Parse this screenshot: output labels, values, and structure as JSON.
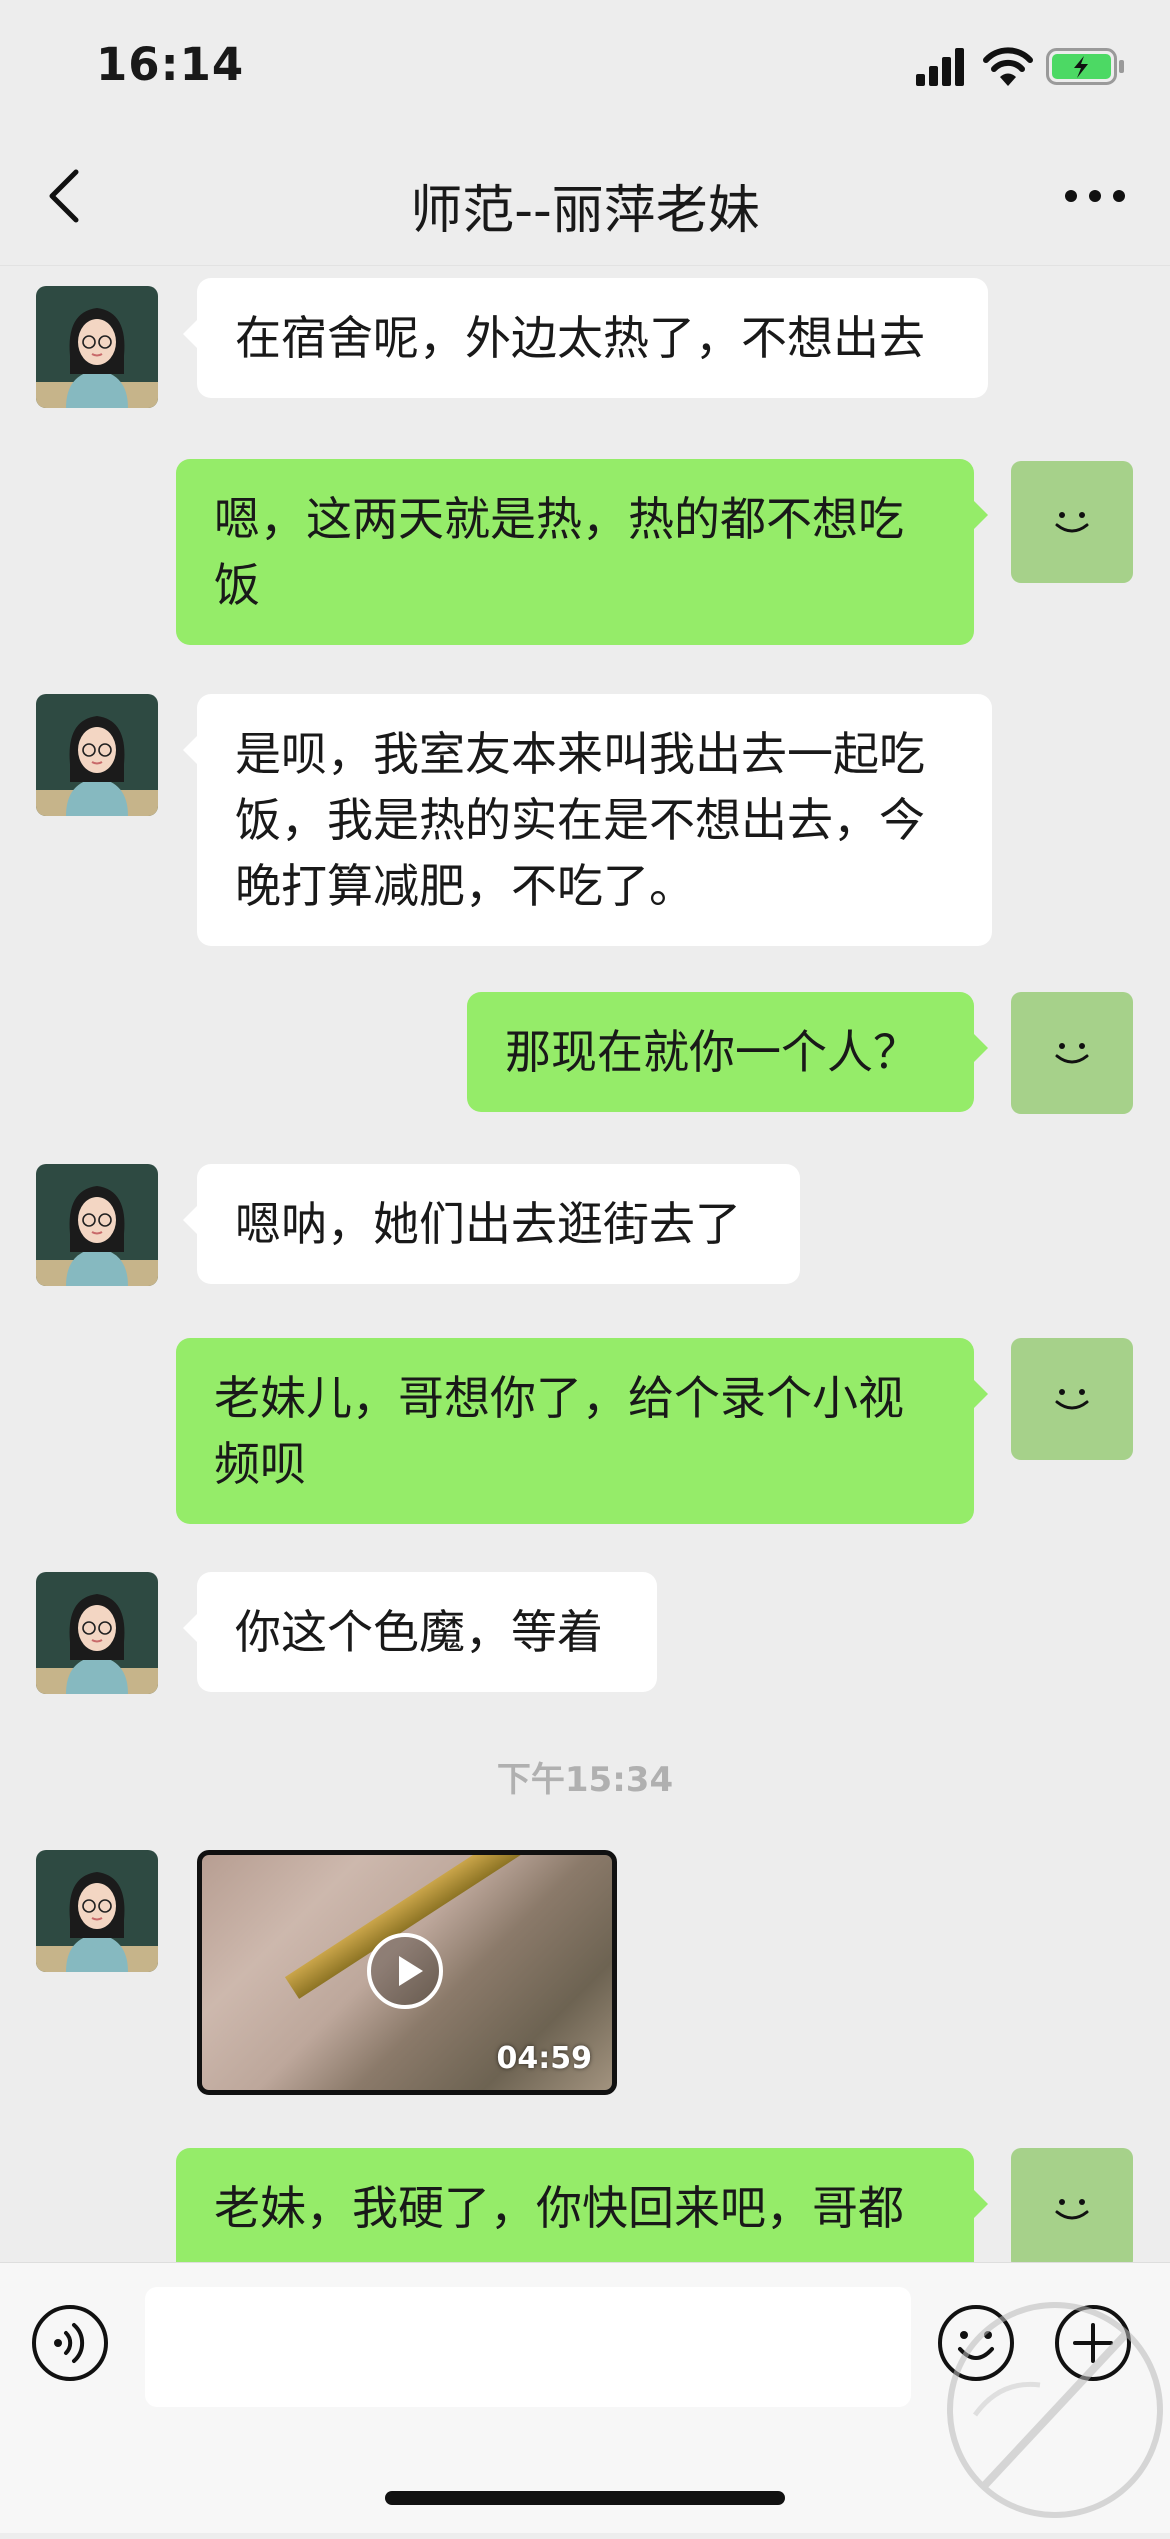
{
  "status_bar": {
    "time": "16:14"
  },
  "header": {
    "title": "师范--丽萍老妹"
  },
  "messages": [
    {
      "from": "her",
      "text": "在宿舍呢，外边太热了，不想出去"
    },
    {
      "from": "me",
      "line1": "嗯，这两天就是热，热的都不想吃",
      "line2": "饭"
    },
    {
      "from": "her",
      "line1": "是呗，我室友本来叫我出去一起吃",
      "line2": "饭，我是热的实在是不想出去，今",
      "line3": "晚打算减肥，不吃了。"
    },
    {
      "from": "me",
      "text": "那现在就你一个人？"
    },
    {
      "from": "her",
      "text": "嗯呐，她们出去逛街去了"
    },
    {
      "from": "me",
      "line1": "老妹儿，哥想你了，给个录个小视",
      "line2": "频呗"
    },
    {
      "from": "her",
      "text": "你这个色魔，等着"
    },
    {
      "from": "her",
      "type": "video",
      "duration": "04:59"
    },
    {
      "from": "me",
      "line1": "老妹，我硬了，你快回来吧，哥都"
    }
  ],
  "time_separator": "下午15:34",
  "input": {
    "placeholder": ""
  },
  "icons": {
    "back": "chevron-left-icon",
    "more": "more-dots-icon",
    "voice": "voice-icon",
    "emoji": "emoji-icon",
    "plus": "plus-icon"
  },
  "colors": {
    "background": "#ededed",
    "outgoing_bubble": "#95ec69",
    "incoming_bubble": "#ffffff",
    "battery": "#4cd964"
  }
}
